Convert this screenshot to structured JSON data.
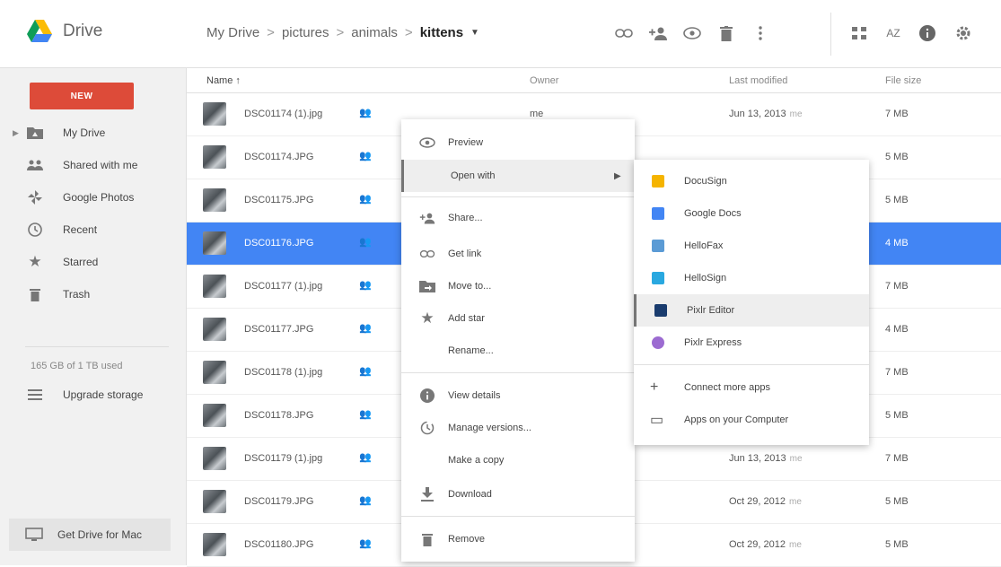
{
  "app": {
    "name": "Drive"
  },
  "breadcrumb": {
    "items": [
      "My Drive",
      "pictures",
      "animals"
    ],
    "separator": ">",
    "current": "kittens"
  },
  "toolbar": {
    "icons": [
      "link-icon",
      "add-person-icon",
      "eye-icon",
      "trash-icon",
      "more-vert-icon",
      "grid-view-icon",
      "sort-az-icon",
      "info-icon",
      "settings-icon"
    ],
    "sort_label": "AZ"
  },
  "sidebar": {
    "new_label": "NEW",
    "items": [
      {
        "label": "My Drive",
        "icon": "folder-drive-icon"
      },
      {
        "label": "Shared with me",
        "icon": "people-icon"
      },
      {
        "label": "Google Photos",
        "icon": "pinwheel-icon"
      },
      {
        "label": "Recent",
        "icon": "clock-icon"
      },
      {
        "label": "Starred",
        "icon": "star-icon"
      },
      {
        "label": "Trash",
        "icon": "trash-icon"
      }
    ],
    "storage": "165 GB of 1 TB used",
    "upgrade_label": "Upgrade storage",
    "get_drive_label": "Get Drive for Mac"
  },
  "table": {
    "columns": {
      "name": "Name ↑",
      "owner": "Owner",
      "modified": "Last modified",
      "size": "File size"
    },
    "rows": [
      {
        "name": "DSC01174 (1).jpg",
        "owner": "me",
        "modified": "Jun 13, 2013",
        "by": "me",
        "size": "7 MB"
      },
      {
        "name": "DSC01174.JPG",
        "owner": "",
        "modified": "",
        "by": "",
        "size": "5 MB"
      },
      {
        "name": "DSC01175.JPG",
        "owner": "",
        "modified": "",
        "by": "",
        "size": "5 MB"
      },
      {
        "name": "DSC01176.JPG",
        "owner": "",
        "modified": "",
        "by": "",
        "size": "4 MB"
      },
      {
        "name": "DSC01177 (1).jpg",
        "owner": "",
        "modified": "",
        "by": "",
        "size": "7 MB"
      },
      {
        "name": "DSC01177.JPG",
        "owner": "",
        "modified": "",
        "by": "",
        "size": "4 MB"
      },
      {
        "name": "DSC01178 (1).jpg",
        "owner": "",
        "modified": "",
        "by": "",
        "size": "7 MB"
      },
      {
        "name": "DSC01178.JPG",
        "owner": "",
        "modified": "",
        "by": "",
        "size": "5 MB"
      },
      {
        "name": "DSC01179 (1).jpg",
        "owner": "",
        "modified": "Jun 13, 2013",
        "by": "me",
        "size": "7 MB"
      },
      {
        "name": "DSC01179.JPG",
        "owner": "",
        "modified": "Oct 29, 2012",
        "by": "me",
        "size": "5 MB"
      },
      {
        "name": "DSC01180.JPG",
        "owner": "",
        "modified": "Oct 29, 2012",
        "by": "me",
        "size": "5 MB"
      }
    ]
  },
  "context_menu": {
    "items": [
      {
        "label": "Preview",
        "icon": "eye-icon"
      },
      {
        "label": "Open with",
        "icon": "",
        "has_submenu": true
      },
      {
        "label": "Share...",
        "icon": "add-person-icon"
      },
      {
        "label": "Get link",
        "icon": "link-icon"
      },
      {
        "label": "Move to...",
        "icon": "folder-move-icon"
      },
      {
        "label": "Add star",
        "icon": "star-icon"
      },
      {
        "label": "Rename...",
        "icon": ""
      },
      {
        "label": "View details",
        "icon": "info-icon"
      },
      {
        "label": "Manage versions...",
        "icon": "history-icon"
      },
      {
        "label": "Make a copy",
        "icon": ""
      },
      {
        "label": "Download",
        "icon": "download-icon"
      },
      {
        "label": "Remove",
        "icon": "trash-icon"
      }
    ]
  },
  "submenu": {
    "items": [
      {
        "label": "DocuSign",
        "color": "#f5b400"
      },
      {
        "label": "Google Docs",
        "color": "#4285f4"
      },
      {
        "label": "HelloFax",
        "color": "#5b9bd5"
      },
      {
        "label": "HelloSign",
        "color": "#29a8e0"
      },
      {
        "label": "Pixlr Editor",
        "color": "#1a3c6e"
      },
      {
        "label": "Pixlr Express",
        "color": "#9c6bd1"
      },
      {
        "label": "Connect more apps",
        "glyph": "+"
      },
      {
        "label": "Apps on your Computer",
        "glyph": "▭"
      }
    ]
  },
  "colors": {
    "new_button": "#dd4b39",
    "selected_row": "#4285f4"
  }
}
